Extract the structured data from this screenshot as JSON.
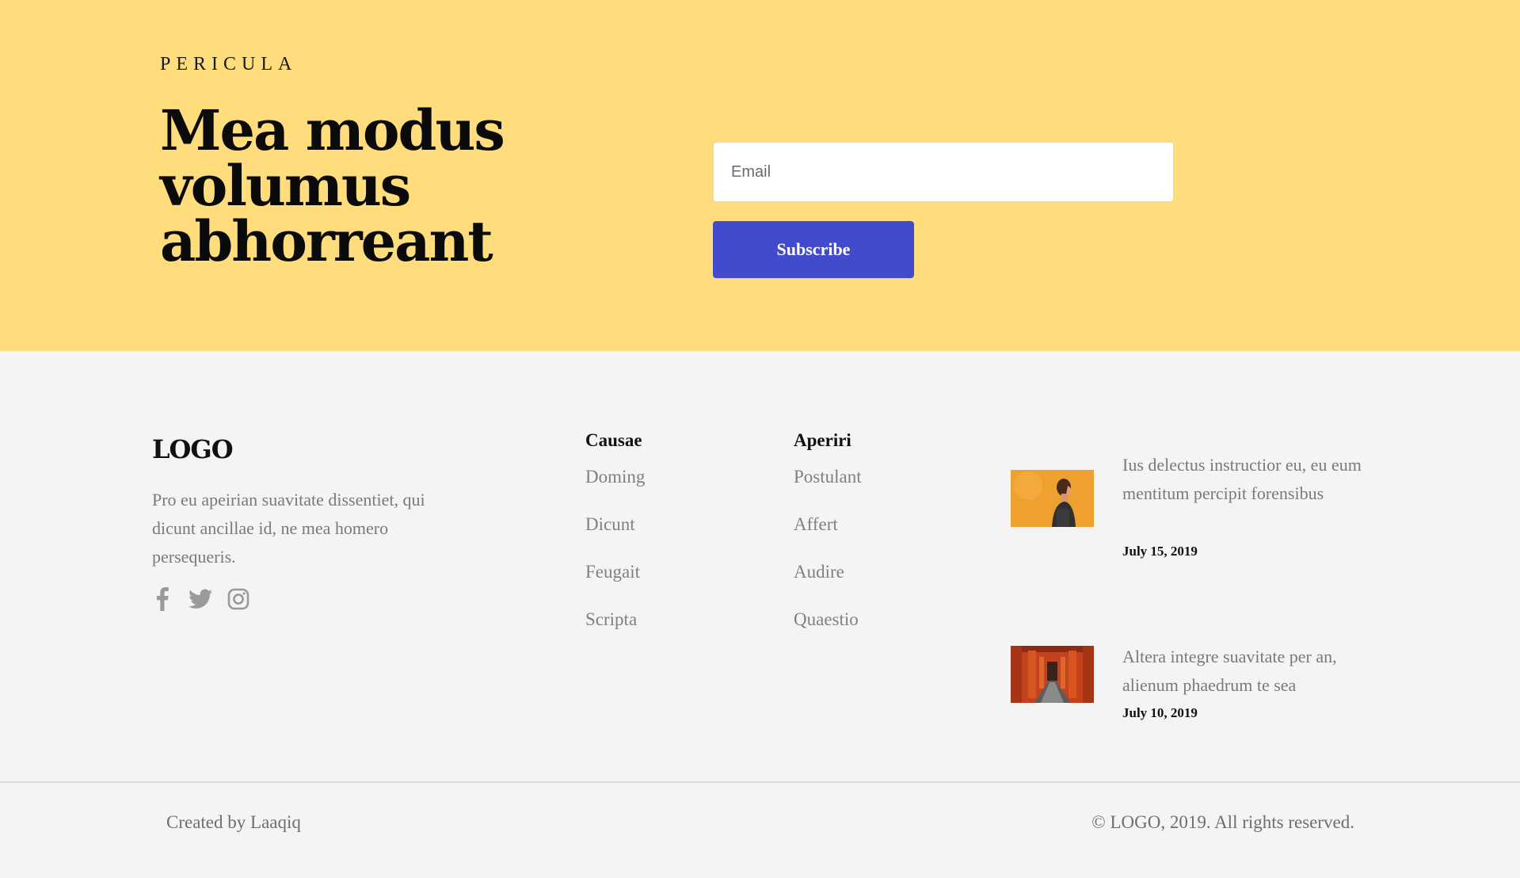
{
  "newsletter": {
    "eyebrow": "PERICULA",
    "headline": "Mea modus volumus abhorreant",
    "email_placeholder": "Email",
    "email_value": "",
    "subscribe_label": "Subscribe"
  },
  "footer": {
    "logo": "LOGO",
    "about": "Pro eu apeirian suavitate dissentiet, qui dicunt ancillae id, ne mea homero persequeris.",
    "social_icons": [
      "facebook-icon",
      "twitter-icon",
      "instagram-icon"
    ],
    "columns": [
      {
        "heading": "Causae",
        "links": [
          "Doming",
          "Dicunt",
          "Feugait",
          "Scripta"
        ]
      },
      {
        "heading": "Aperiri",
        "links": [
          "Postulant",
          "Affert",
          "Audire",
          "Quaestio"
        ]
      }
    ],
    "posts": [
      {
        "title": "Ius delectus instructior eu, eu eum mentitum percipit forensibus",
        "date": "July 15, 2019"
      },
      {
        "title": "Altera integre suavitate per an, alienum phaedrum te sea",
        "date": "July 10, 2019"
      }
    ]
  },
  "bottom_bar": {
    "credit": "Created by Laaqiq",
    "copyright": "© LOGO, 2019. All rights reserved."
  },
  "colors": {
    "newsletter_bg": "#ffdd7d",
    "button_bg": "#434bcd",
    "footer_bg": "#f4f4f4"
  }
}
